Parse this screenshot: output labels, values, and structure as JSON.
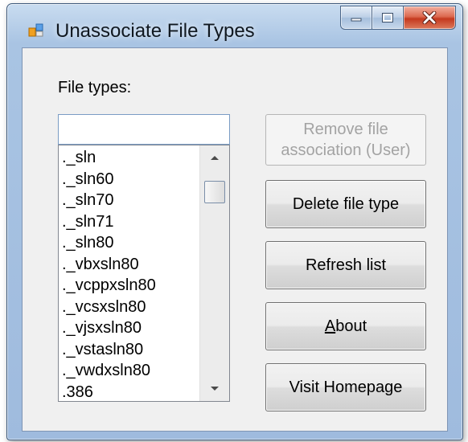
{
  "window": {
    "title": "Unassociate File Types"
  },
  "main": {
    "file_types_label": "File types:",
    "filter_value": "",
    "file_types": [
      "._sln",
      "._sln60",
      "._sln70",
      "._sln71",
      "._sln80",
      "._vbxsln80",
      "._vcppxsln80",
      "._vcsxsln80",
      "._vjsxsln80",
      "._vstasln80",
      "._vwdxsln80",
      ".386"
    ]
  },
  "buttons": {
    "remove_association": "Remove file\nassociation (User)",
    "delete_file_type": "Delete file type",
    "refresh_list": "Refresh list",
    "about": "About",
    "visit_homepage": "Visit Homepage"
  },
  "colors": {
    "titlebar": "#a9c4e3",
    "client_bg": "#f0f0f0",
    "close_button": "#c5391f",
    "disabled_text": "#a3a3a3"
  },
  "icons": {
    "app": "window-app-icon",
    "minimize": "minimize-icon",
    "maximize": "maximize-icon",
    "close": "close-icon",
    "scroll_up": "scroll-up-arrow-icon",
    "scroll_down": "scroll-down-arrow-icon"
  }
}
